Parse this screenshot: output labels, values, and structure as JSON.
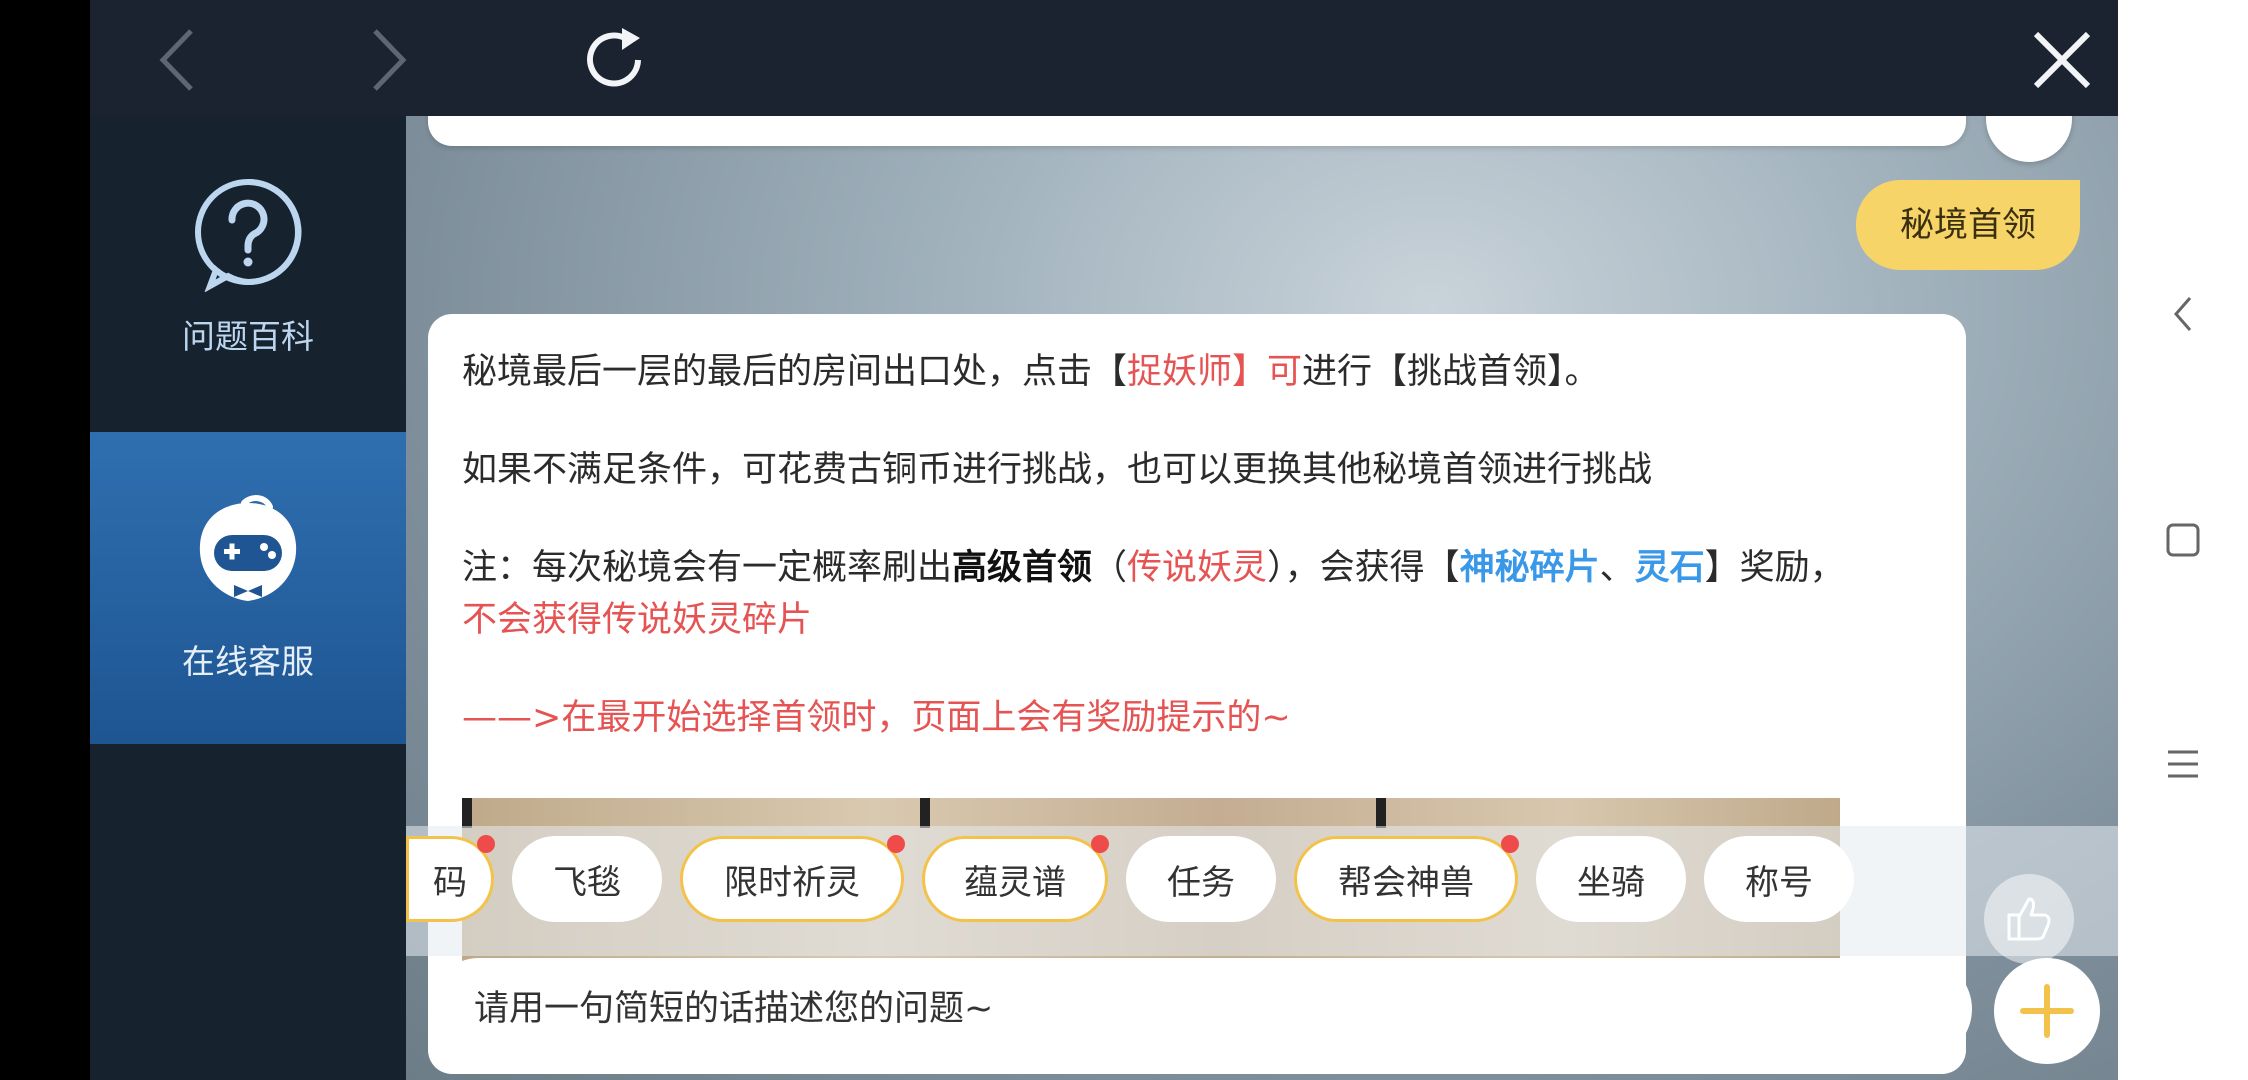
{
  "topbar": {
    "back_icon": "chevron-left-icon",
    "forward_icon": "chevron-right-icon",
    "refresh_icon": "refresh-icon",
    "close_icon": "close-icon"
  },
  "sidebar": {
    "items": [
      {
        "label": "问题百科",
        "icon": "question-bubble-icon",
        "active": false
      },
      {
        "label": "在线客服",
        "icon": "gamepad-mascot-icon",
        "active": true
      }
    ]
  },
  "chat": {
    "user_message": "秘境首领",
    "reply": {
      "p1": {
        "a": "秘境最后一层的最后的房间出口处，点击【",
        "b": "捉妖师】可",
        "c": "进行【挑战首领】。"
      },
      "p2": "如果不满足条件，可花费古铜币进行挑战，也可以更换其他秘境首领进行挑战",
      "p3": {
        "a": "注：每次秘境会有一定概率刷出",
        "b": "高级首领",
        "c": "（",
        "d": "传说妖灵",
        "e": "），会获得【",
        "f": "神秘碎片",
        "g": "、",
        "h": "灵石",
        "i": "】奖励，",
        "j": "不会获得传说妖灵碎片"
      },
      "p4": "——>在最开始选择首领时，页面上会有奖励提示的~"
    }
  },
  "quick_chips": [
    {
      "label": "码",
      "hot": true
    },
    {
      "label": "飞毯",
      "hot": false
    },
    {
      "label": "限时祈灵",
      "hot": true
    },
    {
      "label": "蕴灵谱",
      "hot": true
    },
    {
      "label": "任务",
      "hot": false
    },
    {
      "label": "帮会神兽",
      "hot": true
    },
    {
      "label": "坐骑",
      "hot": false
    },
    {
      "label": "称号",
      "hot": false
    }
  ],
  "input": {
    "placeholder": "请用一句简短的话描述您的问题~"
  },
  "colors": {
    "accent_yellow": "#f3c24a",
    "highlight_red": "#e55353",
    "highlight_blue": "#3a98e8",
    "sidebar_active": "#2f6fb0"
  }
}
